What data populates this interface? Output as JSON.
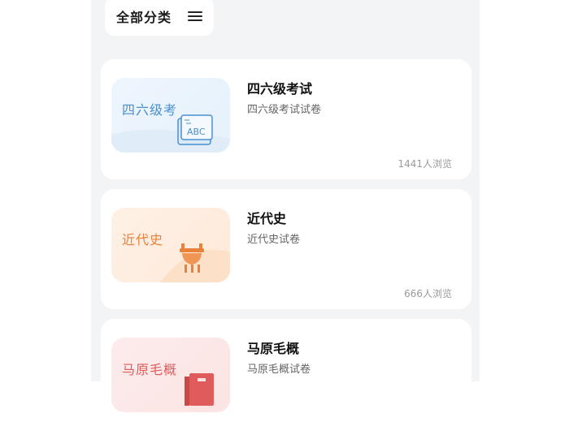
{
  "filter": {
    "label": "全部分类",
    "icon": "menu-icon"
  },
  "cards": [
    {
      "thumb_text": "四六级考",
      "title": "四六级考试",
      "subtitle": "四六级考试试卷",
      "views": "1441人浏览",
      "icon": "abc-book-icon"
    },
    {
      "thumb_text": "近代史",
      "title": "近代史",
      "subtitle": "近代史试卷",
      "views": "666人浏览",
      "icon": "bronze-ding-icon"
    },
    {
      "thumb_text": "马原毛概",
      "title": "马原毛概",
      "subtitle": "马原毛概试卷",
      "views": "",
      "icon": "red-book-icon"
    }
  ],
  "colors": {
    "blue": "#4a8fd0",
    "orange": "#e8813a",
    "red": "#e05b5b",
    "background": "#f3f4f6"
  }
}
